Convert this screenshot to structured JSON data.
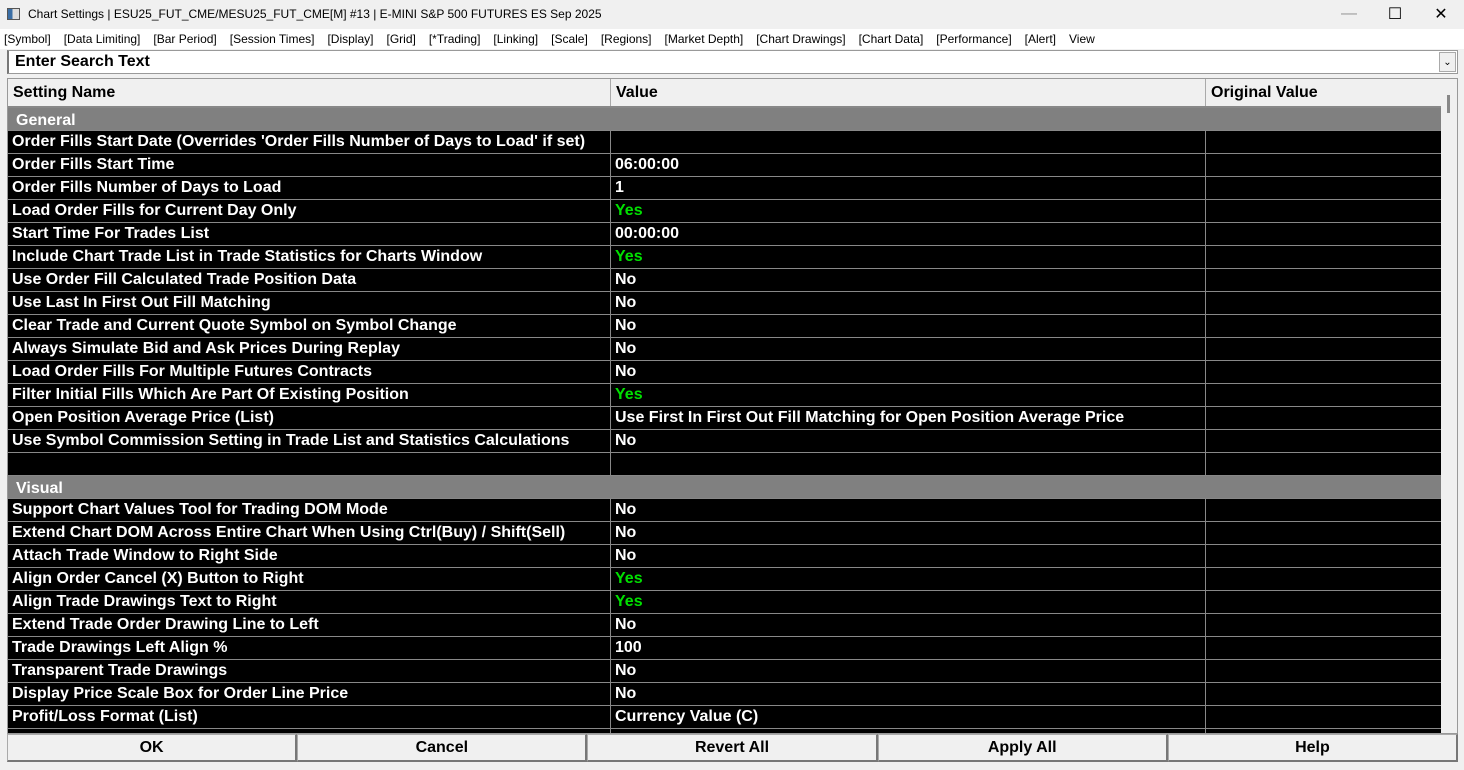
{
  "window": {
    "title": "Chart Settings | ESU25_FUT_CME/MESU25_FUT_CME[M] #13 | E-MINI S&P 500 FUTURES ES Sep 2025",
    "minimize": "—",
    "maximize": "☐",
    "close": "✕"
  },
  "menu": [
    "[Symbol]",
    "[Data Limiting]",
    "[Bar Period]",
    "[Session Times]",
    "[Display]",
    "[Grid]",
    "[*Trading]",
    "[Linking]",
    "[Scale]",
    "[Regions]",
    "[Market Depth]",
    "[Chart Drawings]",
    "[Chart Data]",
    "[Performance]",
    "[Alert]",
    "View"
  ],
  "search": {
    "placeholder": "Enter Search Text",
    "dropdown": "⌄"
  },
  "columns": {
    "name": "Setting Name",
    "value": "Value",
    "original": "Original Value"
  },
  "sections": [
    {
      "title": "General",
      "rows": [
        [
          "Order Fills Start Date (Overrides 'Order Fills Number of Days to Load' if set)",
          ""
        ],
        [
          "Order Fills Start Time",
          "06:00:00"
        ],
        [
          "Order Fills Number of Days to Load",
          "1"
        ],
        [
          "Load Order Fills for Current Day Only",
          "Yes"
        ],
        [
          "Start Time For Trades List",
          "00:00:00"
        ],
        [
          "Include Chart Trade List in Trade Statistics for Charts Window",
          "Yes"
        ],
        [
          "Use Order Fill Calculated Trade Position Data",
          "No"
        ],
        [
          "Use Last In First Out Fill Matching",
          "No"
        ],
        [
          "Clear Trade and Current Quote Symbol on Symbol Change",
          "No"
        ],
        [
          "Always Simulate Bid and Ask Prices During Replay",
          "No"
        ],
        [
          "Load Order Fills For Multiple Futures Contracts",
          "No"
        ],
        [
          "Filter Initial Fills Which Are Part Of Existing Position",
          "Yes"
        ],
        [
          "Open Position Average Price (List)",
          "Use First In First Out Fill Matching for Open Position Average Price"
        ],
        [
          "Use Symbol Commission Setting in Trade List and Statistics Calculations",
          "No"
        ]
      ]
    },
    {
      "title": "Visual",
      "rows": [
        [
          "Support Chart Values Tool for Trading DOM Mode",
          "No"
        ],
        [
          "Extend Chart DOM Across Entire Chart When Using Ctrl(Buy) / Shift(Sell)",
          "No"
        ],
        [
          "Attach Trade Window to Right Side",
          "No"
        ],
        [
          "Align Order Cancel (X) Button to Right",
          "Yes"
        ],
        [
          "Align Trade Drawings Text to Right",
          "Yes"
        ],
        [
          "Extend Trade Order Drawing Line to Left",
          "No"
        ],
        [
          "Trade Drawings Left Align %",
          "100"
        ],
        [
          "Transparent Trade Drawings",
          "No"
        ],
        [
          "Display Price Scale Box for Order Line Price",
          "No"
        ],
        [
          "Profit/Loss Format (List)",
          "Currency Value (C)"
        ]
      ]
    }
  ],
  "colors": {
    "yes": "#00e000",
    "section": "#808080"
  },
  "buttons": [
    "OK",
    "Cancel",
    "Revert All",
    "Apply All",
    "Help"
  ]
}
